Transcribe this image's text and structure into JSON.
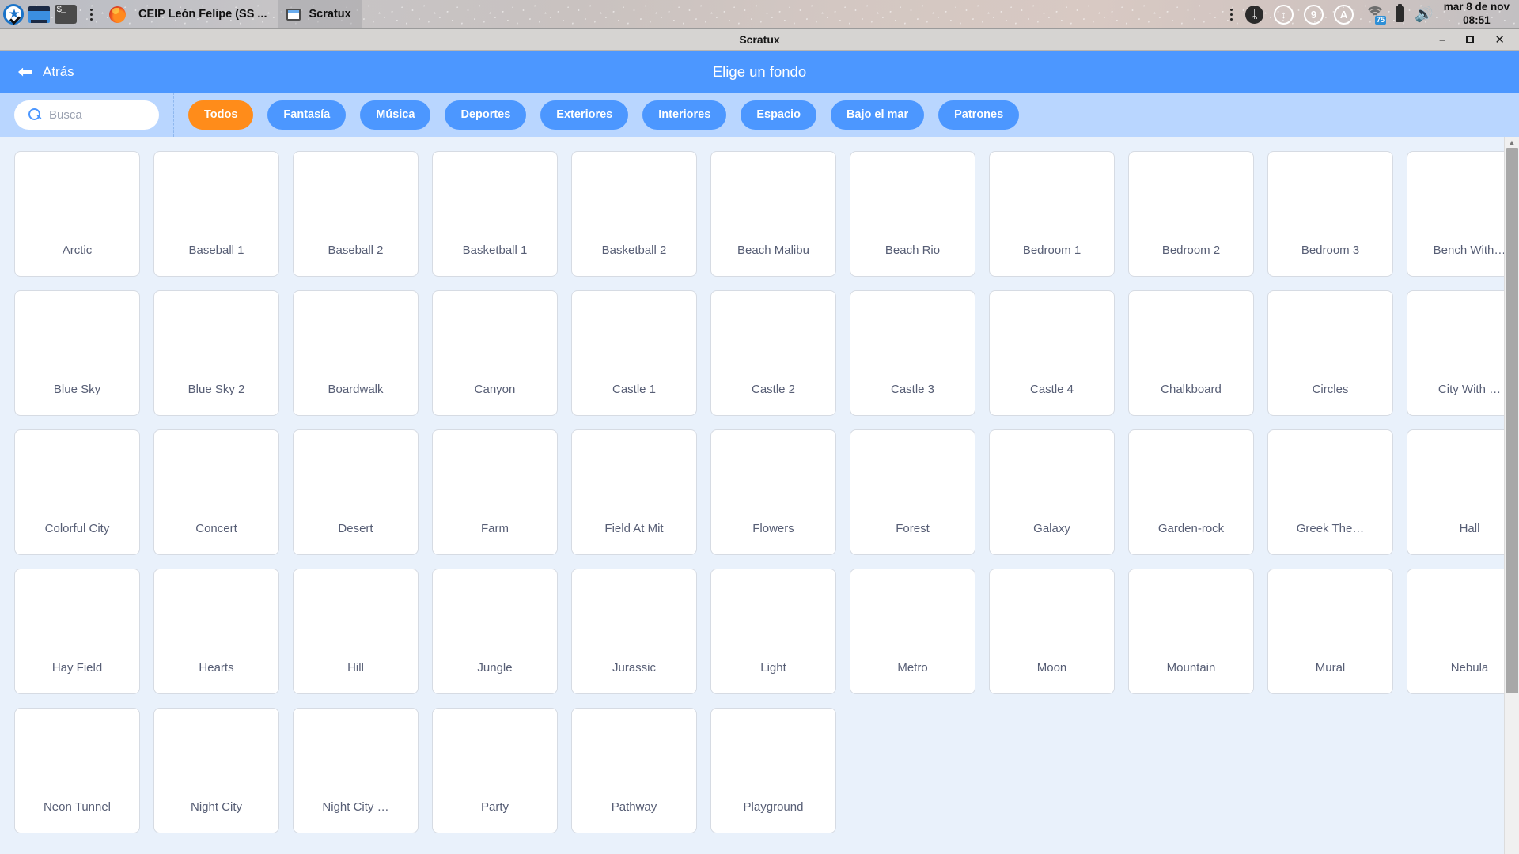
{
  "taskbar": {
    "launchers": [
      {
        "name": "scratux-logo-icon",
        "icon": "scratch-logo"
      },
      {
        "name": "window-manager-icon",
        "icon": "window-blue"
      },
      {
        "name": "terminal-icon",
        "icon": "terminal",
        "glyph": "$_"
      },
      {
        "name": "app-menu-icon",
        "icon": "dots-vertical"
      },
      {
        "name": "firefox-icon",
        "icon": "firefox"
      }
    ],
    "tasks": [
      {
        "label": "CEIP León Felipe (SS ...",
        "active": false
      },
      {
        "label": "Scratux",
        "active": true
      }
    ],
    "tray": {
      "overflow_icon": "dots-vertical-icon",
      "bluetooth_glyph": "ᛦ",
      "indicators": [
        {
          "name": "download-indicator",
          "glyph": "↕"
        },
        {
          "name": "numlock-indicator",
          "glyph": "9"
        },
        {
          "name": "keyboard-layout-indicator",
          "glyph": "A"
        }
      ],
      "wifi_level": "75",
      "volume_glyph": "🔊"
    },
    "clock": {
      "date": "mar  8 de nov",
      "time": "08:51"
    }
  },
  "window": {
    "title": "Scratux",
    "controls": {
      "minimize": "–",
      "maximize": "□",
      "close": "✕"
    }
  },
  "app_header": {
    "back_label": "Atrás",
    "title": "Elige un fondo"
  },
  "filter_bar": {
    "search": {
      "placeholder": "Busca",
      "value": ""
    },
    "categories": [
      {
        "label": "Todos",
        "selected": true
      },
      {
        "label": "Fantasía",
        "selected": false
      },
      {
        "label": "Música",
        "selected": false
      },
      {
        "label": "Deportes",
        "selected": false
      },
      {
        "label": "Exteriores",
        "selected": false
      },
      {
        "label": "Interiores",
        "selected": false
      },
      {
        "label": "Espacio",
        "selected": false
      },
      {
        "label": "Bajo el mar",
        "selected": false
      },
      {
        "label": "Patrones",
        "selected": false
      }
    ]
  },
  "library": {
    "items": [
      {
        "label": "Arctic"
      },
      {
        "label": "Baseball 1"
      },
      {
        "label": "Baseball 2"
      },
      {
        "label": "Basketball 1"
      },
      {
        "label": "Basketball 2"
      },
      {
        "label": "Beach Malibu"
      },
      {
        "label": "Beach Rio"
      },
      {
        "label": "Bedroom 1"
      },
      {
        "label": "Bedroom 2"
      },
      {
        "label": "Bedroom 3"
      },
      {
        "label": "Bench With…"
      },
      {
        "label": "Blue Sky"
      },
      {
        "label": "Blue Sky 2"
      },
      {
        "label": "Boardwalk"
      },
      {
        "label": "Canyon"
      },
      {
        "label": "Castle 1"
      },
      {
        "label": "Castle 2"
      },
      {
        "label": "Castle 3"
      },
      {
        "label": "Castle 4"
      },
      {
        "label": "Chalkboard"
      },
      {
        "label": "Circles"
      },
      {
        "label": "City With …"
      },
      {
        "label": "Colorful City"
      },
      {
        "label": "Concert"
      },
      {
        "label": "Desert"
      },
      {
        "label": "Farm"
      },
      {
        "label": "Field At Mit"
      },
      {
        "label": "Flowers"
      },
      {
        "label": "Forest"
      },
      {
        "label": "Galaxy"
      },
      {
        "label": "Garden-rock"
      },
      {
        "label": "Greek The…"
      },
      {
        "label": "Hall"
      },
      {
        "label": "Hay Field"
      },
      {
        "label": "Hearts"
      },
      {
        "label": "Hill"
      },
      {
        "label": "Jungle"
      },
      {
        "label": "Jurassic"
      },
      {
        "label": "Light"
      },
      {
        "label": "Metro"
      },
      {
        "label": "Moon"
      },
      {
        "label": "Mountain"
      },
      {
        "label": "Mural"
      },
      {
        "label": "Nebula"
      },
      {
        "label": "Neon Tunnel"
      },
      {
        "label": "Night City"
      },
      {
        "label": "Night City …"
      },
      {
        "label": "Party"
      },
      {
        "label": "Pathway"
      },
      {
        "label": "Playground"
      }
    ]
  },
  "scrollbar": {
    "up_arrow": "▲"
  },
  "colors": {
    "accent_blue": "#4c97ff",
    "selected_orange": "#ff8c1a",
    "filter_bar_bg": "#b9d6ff",
    "grid_bg": "#e9f1fb",
    "label_text": "#575e75"
  }
}
